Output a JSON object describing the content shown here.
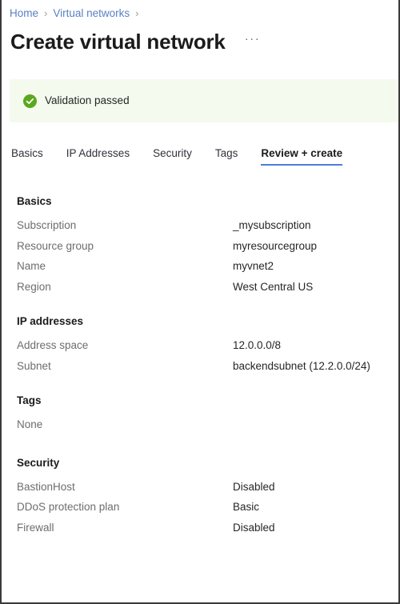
{
  "breadcrumb": {
    "items": [
      {
        "label": "Home",
        "separator": "›"
      },
      {
        "label": "Virtual networks",
        "separator": "›"
      }
    ],
    "sep0": "›",
    "sep1": "›",
    "item0": "Home",
    "item1": "Virtual networks"
  },
  "header": {
    "title": "Create virtual network",
    "more_label": "···"
  },
  "banner": {
    "text": "Validation passed",
    "icon": "check-circle-icon",
    "background_color": "#f4fbee",
    "icon_color": "#5ba81f"
  },
  "tabs": {
    "accent_color": "#4f7fd4",
    "items": [
      {
        "label": "Basics",
        "active": false
      },
      {
        "label": "IP Addresses",
        "active": false
      },
      {
        "label": "Security",
        "active": false
      },
      {
        "label": "Tags",
        "active": false
      },
      {
        "label": "Review + create",
        "active": true
      }
    ]
  },
  "sections": [
    {
      "heading": "Basics",
      "rows": [
        {
          "key": "Subscription",
          "value": "_mysubscription"
        },
        {
          "key": "Resource group",
          "value": "myresourcegroup"
        },
        {
          "key": "Name",
          "value": "myvnet2"
        },
        {
          "key": "Region",
          "value": "West Central US"
        }
      ]
    },
    {
      "heading": "IP addresses",
      "rows": [
        {
          "key": "Address space",
          "value": "12.0.0.0/8"
        },
        {
          "key": "Subnet",
          "value": "backendsubnet (12.2.0.0/24)"
        }
      ]
    },
    {
      "heading": "Tags",
      "empty_text": "None",
      "rows": []
    },
    {
      "heading": "Security",
      "rows": [
        {
          "key": "BastionHost",
          "value": "Disabled"
        },
        {
          "key": "DDoS protection plan",
          "value": "Basic"
        },
        {
          "key": "Firewall",
          "value": "Disabled"
        }
      ]
    }
  ]
}
